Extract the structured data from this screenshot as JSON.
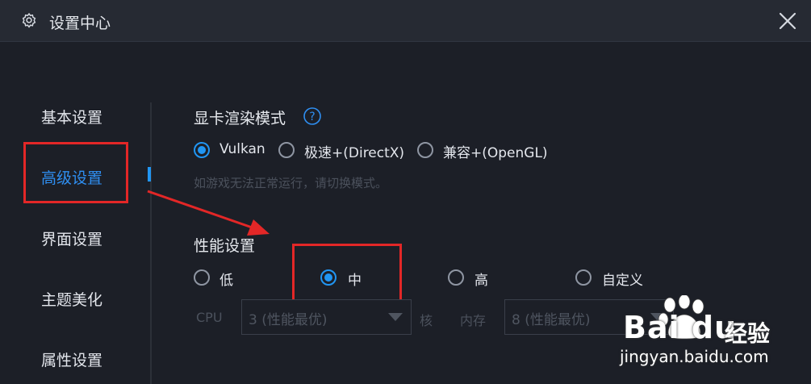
{
  "window": {
    "title": "设置中心"
  },
  "sidebar": {
    "items": [
      {
        "label": "基本设置"
      },
      {
        "label": "高级设置",
        "active": true
      },
      {
        "label": "界面设置"
      },
      {
        "label": "主题美化"
      },
      {
        "label": "属性设置"
      }
    ]
  },
  "render": {
    "title": "显卡渲染模式",
    "options": [
      {
        "label": "Vulkan",
        "selected": true
      },
      {
        "label": "极速+(DirectX)",
        "selected": false
      },
      {
        "label": "兼容+(OpenGL)",
        "selected": false
      }
    ],
    "hint": "如游戏无法正常运行，请切换模式。"
  },
  "performance": {
    "title": "性能设置",
    "options": [
      {
        "label": "低",
        "selected": false
      },
      {
        "label": "中",
        "selected": true
      },
      {
        "label": "高",
        "selected": false
      },
      {
        "label": "自定义",
        "selected": false
      }
    ],
    "cpu_label": "CPU",
    "cpu_value": "3 (性能最优)",
    "cores_label": "核",
    "memory_label": "内存",
    "memory_value": "8 (性能最优)"
  },
  "watermark": {
    "brand": "Bai du",
    "product": "经验",
    "url": "jingyan.baidu.com"
  },
  "colors": {
    "accent": "#2196f3",
    "annotation_red": "#e32727",
    "background": "#1c1f27",
    "titlebar": "#262a33"
  },
  "icons": [
    "gear-icon",
    "close-icon",
    "help-icon",
    "dropdown-arrow-icon",
    "paw-icon"
  ]
}
